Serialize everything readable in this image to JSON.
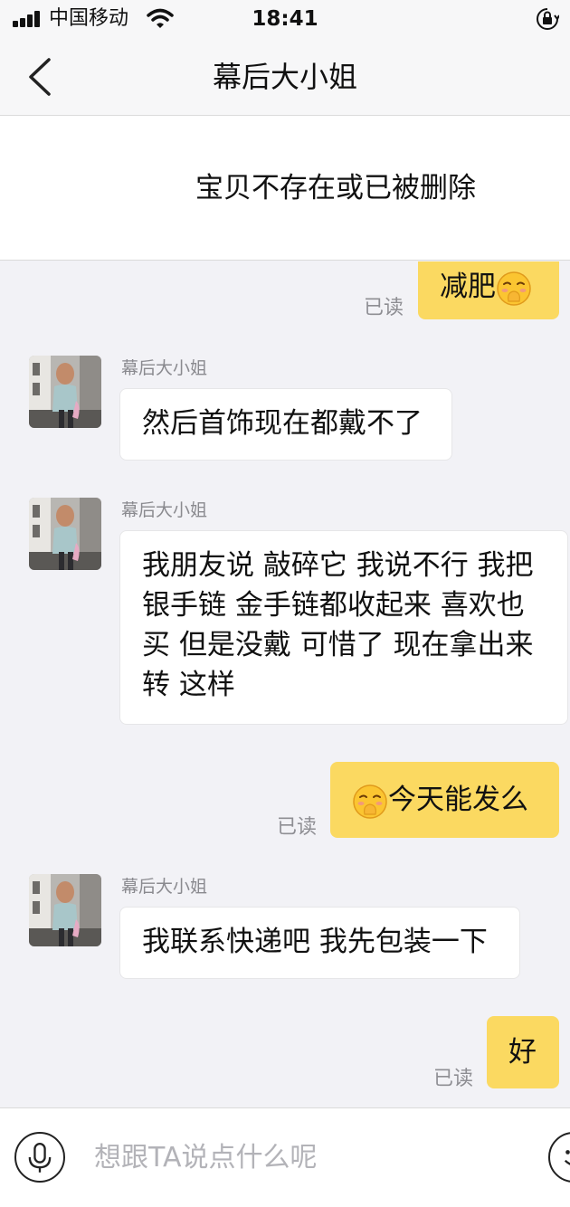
{
  "status_bar": {
    "carrier": "中国移动",
    "time": "18:41"
  },
  "nav": {
    "title": "幕后大小姐"
  },
  "item_card": {
    "text": "宝贝不存在或已被删除"
  },
  "messages": [
    {
      "direction": "out",
      "text": "减肥",
      "emoji_after": "covering-mouth-emoji",
      "status": "已读"
    },
    {
      "direction": "in",
      "sender": "幕后大小姐",
      "lines": [
        "然后首饰现在都戴不了"
      ]
    },
    {
      "direction": "in",
      "sender": "幕后大小姐",
      "lines": [
        "我朋友说 敲碎它 我说不行 我把",
        "银手链 金手链都收起来 喜欢也",
        "买 但是没戴 可惜了 现在拿出来",
        "转 这样"
      ]
    },
    {
      "direction": "out",
      "text": "今天能发么",
      "emoji_before": "covering-mouth-emoji",
      "status": "已读"
    },
    {
      "direction": "in",
      "sender": "幕后大小姐",
      "lines": [
        "我联系快递吧 我先包装一下"
      ]
    },
    {
      "direction": "out",
      "text": "好",
      "status": "已读"
    }
  ],
  "input_bar": {
    "placeholder": "想跟TA说点什么呢",
    "left_icon": "microphone-icon",
    "right_icon": "emoji-icon"
  },
  "colors": {
    "outgoing_bubble": "#fbd961",
    "incoming_bubble": "#ffffff",
    "background": "#f2f2f6"
  }
}
